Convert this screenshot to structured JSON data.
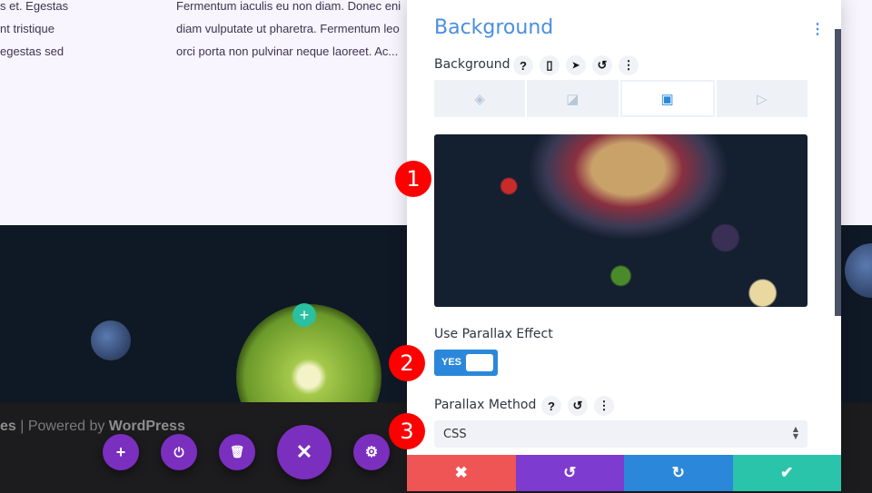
{
  "page": {
    "col1": [
      "s et. Egestas",
      "nt tristique",
      "egestas sed"
    ],
    "col2": [
      "Fermentum iaculis eu non diam. Donec eni",
      "diam vulputate ut pharetra. Fermentum leo",
      "orci porta non pulvinar neque laoreet. Ac..."
    ],
    "footer_prefix": "es",
    "footer_sep": " | Powered by ",
    "footer_brand": "WordPress"
  },
  "fabs": {
    "add": "+",
    "power": "⏻",
    "trash": "🗑",
    "close": "✕",
    "settings": "⚙",
    "add_row": "+"
  },
  "panel": {
    "title": "Background",
    "kebab": "⋮",
    "bg_label": "Background",
    "icons": {
      "help": "?",
      "device": "▯",
      "hover": "➤",
      "reset": "↺",
      "more": "⋮"
    },
    "tabs": [
      {
        "icon": "paint-bucket",
        "glyph": "◈"
      },
      {
        "icon": "gradient",
        "glyph": "◪"
      },
      {
        "icon": "image",
        "glyph": "▣"
      },
      {
        "icon": "video",
        "glyph": "▷"
      }
    ],
    "parallax_label": "Use Parallax Effect",
    "toggle": "YES",
    "method_label": "Parallax Method",
    "method_value": "CSS",
    "actions": {
      "cancel": "✖",
      "undo": "↺",
      "redo": "↻",
      "save": "✔"
    }
  },
  "badges": [
    "1",
    "2",
    "3"
  ],
  "colors": {
    "accent": "#2b87da",
    "purple": "#7b2fbf",
    "red": "#ef5555",
    "undo": "#7e3bd0",
    "redo": "#2b87da",
    "save": "#29c4a9"
  }
}
